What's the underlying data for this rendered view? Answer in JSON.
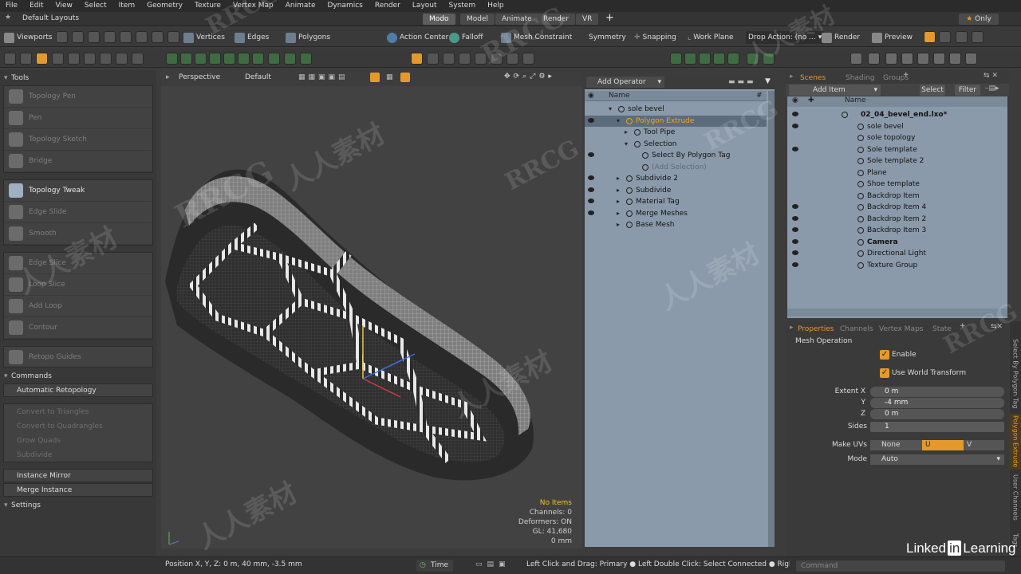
{
  "menu": [
    "File",
    "Edit",
    "View",
    "Select",
    "Item",
    "Geometry",
    "Texture",
    "Vertex Map",
    "Animate",
    "Dynamics",
    "Render",
    "Layout",
    "System",
    "Help"
  ],
  "layout": {
    "name": "Default Layouts",
    "tabs": [
      "Modo",
      "Model",
      "Animate",
      "Render",
      "VR"
    ],
    "add": "+",
    "only": "Only"
  },
  "toolbar1": {
    "viewports": "Viewports",
    "vertices": "Vertices",
    "edges": "Edges",
    "polygons": "Polygons",
    "action_center": "Action Center",
    "falloff": "Falloff",
    "mesh_constraint": "Mesh Constraint",
    "symmetry": "Symmetry",
    "snapping": "Snapping",
    "work_plane": "Work Plane",
    "drop_action": "Drop Action: (no ...",
    "render": "Render",
    "preview": "Preview"
  },
  "tools": {
    "header": "Tools",
    "group1": [
      "Topology Pen",
      "Pen",
      "Topology Sketch",
      "Bridge"
    ],
    "group2": [
      "Topology Tweak",
      "Edge Slide",
      "Smooth"
    ],
    "group3": [
      "Edge Slice",
      "Loop Slice",
      "Add Loop",
      "Contour"
    ],
    "retopo": "Retopo Guides",
    "commands_header": "Commands",
    "auto_retopo": "Automatic Retopology",
    "group4": [
      "Convert to Triangles",
      "Convert to Quadrangles",
      "Grow Quads",
      "Subdivide"
    ],
    "instance_mirror": "Instance Mirror",
    "merge_instance": "Merge Instance",
    "settings": "Settings"
  },
  "viewport": {
    "view": "Perspective",
    "shading": "Default",
    "info": [
      "No Items",
      "Channels: 0",
      "Deformers: ON",
      "GL: 41,680",
      "0 mm"
    ]
  },
  "operator": {
    "add_operator": "Add Operator",
    "col_name": "Name",
    "col_hash": "#",
    "rows": [
      {
        "label": "sole bevel",
        "indent": 1,
        "eye": false
      },
      {
        "label": "Polygon Extrude",
        "indent": 2,
        "eye": true,
        "selected": true
      },
      {
        "label": "Tool Pipe",
        "indent": 3,
        "eye": false
      },
      {
        "label": "Selection",
        "indent": 3,
        "eye": false
      },
      {
        "label": "Select By Polygon Tag",
        "indent": 4,
        "eye": true
      },
      {
        "label": "(Add Selection)",
        "indent": 4,
        "eye": false,
        "dim": true
      },
      {
        "label": "Subdivide 2",
        "indent": 2,
        "eye": true
      },
      {
        "label": "Subdivide",
        "indent": 2,
        "eye": true
      },
      {
        "label": "Material Tag",
        "indent": 2,
        "eye": true
      },
      {
        "label": "Merge Meshes",
        "indent": 2,
        "eye": true
      },
      {
        "label": "Base Mesh",
        "indent": 2,
        "eye": false
      }
    ]
  },
  "scenes": {
    "tabs": [
      "Scenes",
      "Shading",
      "Groups"
    ],
    "add_item": "Add Item",
    "select": "Select",
    "filter": "Filter",
    "col_name": "Name",
    "items": [
      {
        "label": "02_04_bevel_end.lxo*",
        "bold": true,
        "eye": true
      },
      {
        "label": "sole bevel",
        "eye": true
      },
      {
        "label": "sole topology",
        "eye": false
      },
      {
        "label": "Sole template",
        "eye": true
      },
      {
        "label": "Sole template 2",
        "eye": false
      },
      {
        "label": "Plane",
        "eye": false
      },
      {
        "label": "Shoe template",
        "eye": false
      },
      {
        "label": "Backdrop Item",
        "eye": false
      },
      {
        "label": "Backdrop Item 4",
        "eye": true
      },
      {
        "label": "Backdrop Item 2",
        "eye": true
      },
      {
        "label": "Backdrop Item 3",
        "eye": true
      },
      {
        "label": "Camera",
        "bold": true,
        "eye": true
      },
      {
        "label": "Directional Light",
        "eye": true
      },
      {
        "label": "Texture Group",
        "eye": true
      }
    ]
  },
  "properties": {
    "tabs": [
      "Properties",
      "Channels",
      "Vertex Maps",
      "State"
    ],
    "title": "Mesh Operation",
    "enable": "Enable",
    "use_world": "Use World Transform",
    "extent_label": "Extent X",
    "y_label": "Y",
    "z_label": "Z",
    "extent_x": "0 m",
    "extent_y": "-4 mm",
    "extent_z": "0 m",
    "sides_label": "Sides",
    "sides": "1",
    "make_uvs_label": "Make UVs",
    "uv_none": "None",
    "uv_u": "U",
    "uv_v": "V",
    "mode_label": "Mode",
    "mode": "Auto",
    "side_tabs": [
      "Select By Polygon Tag",
      "Polygon Extrude",
      "User Channels",
      "Tags"
    ]
  },
  "status": {
    "position": "Position X, Y, Z:  0 m, 40 mm, -3.5 mm",
    "time": "Time",
    "hint": "Left Click and Drag: Primary ● Left Double Click: Select Connected ● Right Cli...",
    "command": "Command"
  },
  "branding": {
    "linkedin": "Linked",
    "in": "in",
    "learning": "Learning"
  },
  "watermarks": [
    "RRCG",
    "人人素材"
  ],
  "colors": {
    "accent": "#e39a2b",
    "panel": "#3a3a3a",
    "tree": "#8b9aaa"
  }
}
